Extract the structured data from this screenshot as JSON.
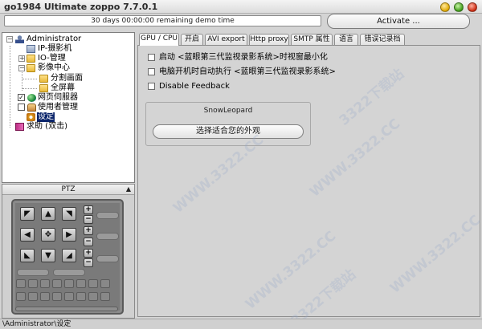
{
  "window": {
    "title": "go1984 Ultimate zoppo 7.7.0.1"
  },
  "demo": {
    "text": "30 days 00:00:00 remaining demo time"
  },
  "activate": {
    "label": "Activate ..."
  },
  "tree": {
    "root": "Administrator",
    "items": [
      "IP-摄影机",
      "IO-管理",
      "影像中心",
      "分割画面",
      "全屏幕",
      "网页伺服器",
      "使用者管理",
      "设定",
      "求助 (双击)"
    ]
  },
  "ptz": {
    "title": "PTZ",
    "collapse": "▲",
    "arrows": [
      "◤",
      "▲",
      "◥",
      "◀",
      "✥",
      "▶",
      "◣",
      "▼",
      "◢"
    ],
    "plus": "+",
    "minus": "−"
  },
  "tabs": [
    "GPU / CPU",
    "开启",
    "AVI export",
    "Http proxy",
    "SMTP 属性",
    "语言",
    "错误记录档"
  ],
  "options": [
    {
      "label": "启动 <蓝眼第三代监视录影系统>时视窗最小化",
      "checked": false
    },
    {
      "label": "电脑开机时自动执行 <蓝眼第三代监视录影系统>",
      "checked": false
    },
    {
      "label": "Disable Feedback",
      "checked": false
    }
  ],
  "skin": {
    "name": "SnowLeopard",
    "button": "选择适合您的外观"
  },
  "status": {
    "text": "\\Administrator\\设定"
  },
  "watermark": "WWW.3322.CC",
  "watermark_cn": "3322下载站"
}
